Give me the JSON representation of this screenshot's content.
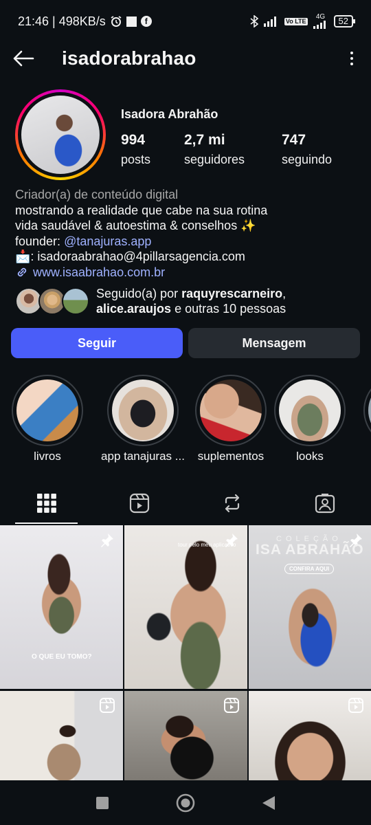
{
  "status_bar": {
    "time_speed": "21:46 | 498KB/s",
    "network": "4G",
    "volte": "Vo LTE",
    "battery": "52"
  },
  "header": {
    "username": "isadorabrahao"
  },
  "profile": {
    "full_name": "Isadora Abrahão",
    "stats": [
      {
        "value": "994",
        "label": "posts"
      },
      {
        "value": "2,7 mi",
        "label": "seguidores"
      },
      {
        "value": "747",
        "label": "seguindo"
      }
    ]
  },
  "bio": {
    "category": "Criador(a) de conteúdo digital",
    "line1": "mostrando a realidade que cabe na sua rotina",
    "line2": "vida saudável & autoestima &  conselhos ✨",
    "founder_prefix": "founder: ",
    "founder_link": "@tanajuras.app",
    "email_line": "📩: isadoraabrahao@4pillarsagencia.com",
    "website": "www.isaabrahao.com.br"
  },
  "followed_by": {
    "prefix": "Seguido(a) por ",
    "user1": "raquyrescarneiro",
    "comma": ",",
    "user2": "alice.araujos",
    "suffix": " e outras 10 pessoas"
  },
  "buttons": {
    "follow": "Seguir",
    "message": "Mensagem"
  },
  "highlights": [
    {
      "label": "livros"
    },
    {
      "label": "app tanajuras ..."
    },
    {
      "label": "suplementos"
    },
    {
      "label": "looks"
    }
  ],
  "grid": {
    "post1_caption": "O QUE EU TOMO?",
    "post2_caption": "tour pelo meu aplicativo",
    "post3_title_small": "COLEÇÃO",
    "post3_title_big": "ISA ABRAHÃO",
    "post3_cta": "CONFIRA AQUI"
  },
  "colors": {
    "background": "#0c1014",
    "follow_button": "#4a5df9",
    "message_button": "#262b31",
    "link": "#9fb1ff"
  },
  "icons": {
    "tabs": [
      "grid-icon",
      "reels-icon",
      "reposts-icon",
      "tagged-icon"
    ]
  }
}
